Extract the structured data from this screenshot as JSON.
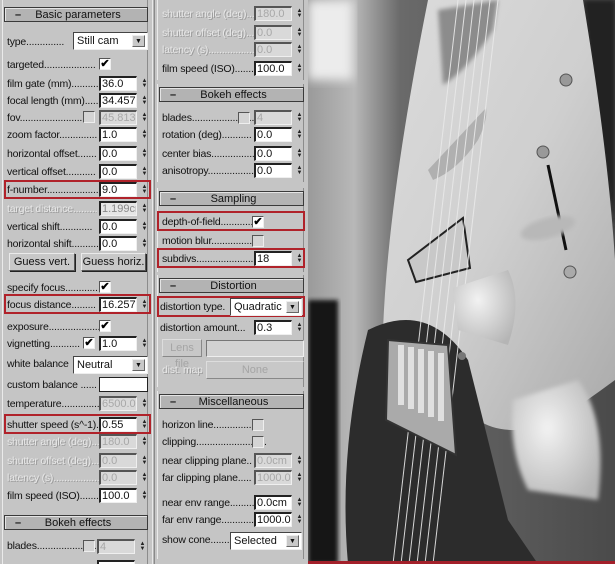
{
  "basic_parameters": {
    "title": "Basic parameters",
    "collapse_symbol": "–",
    "type": {
      "label": "type..............",
      "value": "Still cam"
    },
    "targeted": {
      "label": "targeted...................",
      "checked": true
    },
    "film_gate": {
      "label": "film gate (mm)..........",
      "value": "36.0"
    },
    "focal_length": {
      "label": "focal length (mm).....",
      "value": "34.457"
    },
    "fov": {
      "label": "fov.......................",
      "checked": false,
      "value": "45.813"
    },
    "zoom_factor": {
      "label": "zoom factor..............",
      "value": "1.0"
    },
    "horizontal_offset": {
      "label": "horizontal offset.......",
      "value": "0.0"
    },
    "vertical_offset": {
      "label": "vertical offset...........",
      "value": "0.0"
    },
    "f_number": {
      "label": "f-number.....................",
      "value": "9.0"
    },
    "target_distance": {
      "label": "target distance.........",
      "value": "1.199cr"
    },
    "vertical_shift": {
      "label": "vertical shift............",
      "value": "0.0"
    },
    "horizontal_shift": {
      "label": "horizontal shift..........",
      "value": "0.0"
    },
    "guess_vert": "Guess vert.",
    "guess_horiz": "Guess horiz.",
    "specify_focus": {
      "label": "specify focus............",
      "checked": true
    },
    "focus_distance": {
      "label": "focus distance.........",
      "value": "16.257c"
    },
    "exposure": {
      "label": "exposure.....................",
      "checked": true
    },
    "vignetting": {
      "label": "vignetting...........",
      "checked": true,
      "value": "1.0"
    },
    "white_balance": {
      "label": "white balance",
      "value": "Neutral"
    },
    "custom_balance": {
      "label": "custom balance ......"
    },
    "temperature": {
      "label": "temperature..................",
      "value": "6500.0"
    },
    "shutter_speed": {
      "label": "shutter speed (s^-1).",
      "value": "0.55"
    },
    "shutter_angle": {
      "label": "shutter angle (deg)....",
      "value": "180.0"
    },
    "shutter_offset": {
      "label": "shutter offset (deg)...",
      "value": "0.0"
    },
    "latency": {
      "label": "latency (s)..................",
      "value": "0.0"
    },
    "film_speed": {
      "label": "film speed (ISO).......",
      "value": "100.0"
    }
  },
  "bokeh_left": {
    "title": "Bokeh effects",
    "blades": {
      "label": "blades.........................",
      "checked": false,
      "value": "4"
    }
  },
  "column2_top": {
    "shutter_angle": {
      "label": "shutter angle (deg)....",
      "value": "180.0"
    },
    "shutter_offset": {
      "label": "shutter offset (deg)...",
      "value": "0.0"
    },
    "latency": {
      "label": "latency (s)..................",
      "value": "0.0"
    },
    "film_speed": {
      "label": "film speed (ISO).......",
      "value": "100.0"
    }
  },
  "bokeh_effects": {
    "title": "Bokeh effects",
    "blades": {
      "label": "blades.........................",
      "checked": false,
      "value": "4"
    },
    "rotation": {
      "label": "rotation (deg)...........",
      "value": "0.0"
    },
    "center_bias": {
      "label": "center bias................",
      "value": "0.0"
    },
    "anisotropy": {
      "label": "anisotropy..................",
      "value": "0.0"
    }
  },
  "sampling": {
    "title": "Sampling",
    "depth_of_field": {
      "label": "depth-of-field..............",
      "checked": true
    },
    "motion_blur": {
      "label": "motion blur...................",
      "checked": false
    },
    "subdivs": {
      "label": "subdivs.............................",
      "value": "18"
    }
  },
  "distortion": {
    "title": "Distortion",
    "distortion_type": {
      "label": "distortion type.",
      "value": "Quadratic"
    },
    "distortion_amount": {
      "label": "distortion amount...",
      "value": "0.3"
    },
    "lens_file": "Lens file",
    "dist_map": {
      "label": "dist. map",
      "value": "None"
    }
  },
  "miscellaneous": {
    "title": "Miscellaneous",
    "horizon_line": {
      "label": "horizon line.................",
      "checked": false
    },
    "clipping": {
      "label": "clipping..........................",
      "checked": false
    },
    "near_clipping_plane": {
      "label": "near clipping plane..",
      "value": "0.0cm"
    },
    "far_clipping_plane": {
      "label": "far clipping plane.....",
      "value": "1000.0c"
    },
    "near_env_range": {
      "label": "near env range.........",
      "value": "0.0cm"
    },
    "far_env_range": {
      "label": "far env range............",
      "value": "1000.0c"
    },
    "show_cone": {
      "label": "show cone.......",
      "value": "Selected"
    }
  },
  "icons": {
    "check": "✔",
    "spin_up": "▲",
    "spin_down": "▼",
    "dropdown_arrow": "▼"
  },
  "colors": {
    "panel_bg": "#c5c5c5",
    "highlight_red": "#b0222a"
  },
  "photo": {
    "subject": "black-and-white close-up photo of electric guitar body with shallow depth of field"
  }
}
